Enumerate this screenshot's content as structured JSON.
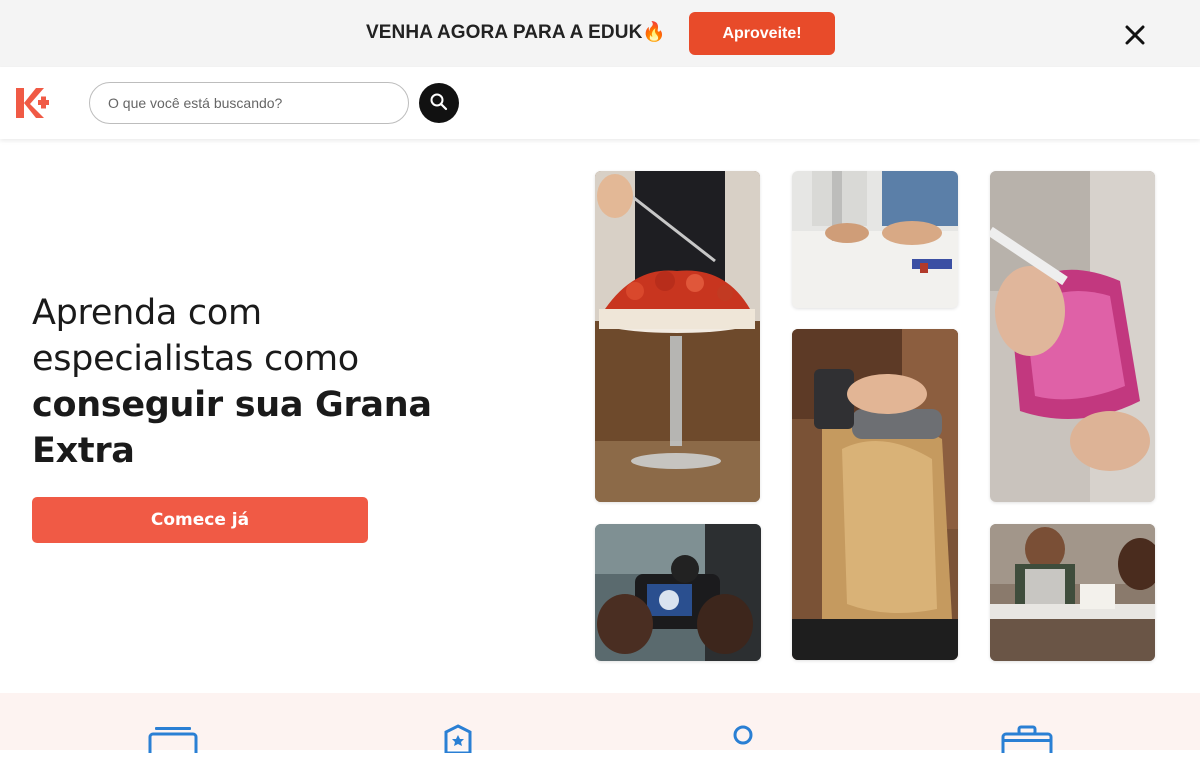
{
  "promo": {
    "text": "VENHA AGORA PARA A EDUK🔥",
    "button_label": "Aproveite!",
    "close_icon": "close-icon"
  },
  "header": {
    "logo_icon": "eduk-logo",
    "search": {
      "placeholder": "O que você está buscando?",
      "value": ""
    },
    "search_icon": "search-icon"
  },
  "hero": {
    "title_line_1": "Aprenda com",
    "title_line_2": "especialistas como",
    "title_bold": "conseguir sua Grana Extra",
    "cta_label": "Comece já",
    "images": [
      "cake-dessert-photo",
      "sewing-machine-photo",
      "glass-engraving-photo",
      "hairdressing-photo",
      "camera-photography-photo",
      "workshop-couple-photo"
    ]
  },
  "features": {
    "icons": [
      "video-course-icon",
      "badge-certificate-icon",
      "instructor-person-icon",
      "briefcase-icon"
    ]
  },
  "colors": {
    "accent": "#e84b2a",
    "cta": "#f05a45",
    "feature_icon": "#2a7fd4",
    "features_bg": "#fdf3f1"
  }
}
